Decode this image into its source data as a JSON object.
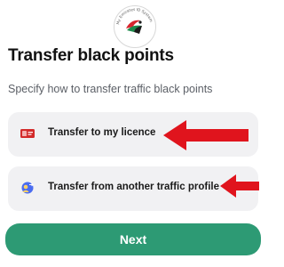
{
  "logo": {
    "arc_text": "My Emirates ID System",
    "icon": "falcon-emblem-icon",
    "colors": {
      "red": "#d7262e",
      "green": "#1f8a4c",
      "black": "#1b1b1b"
    }
  },
  "header": {
    "title": "Transfer black points",
    "subtitle": "Specify how to transfer traffic black points"
  },
  "options": [
    {
      "label": "Transfer to my licence",
      "icon": "licence-card-icon"
    },
    {
      "label": "Transfer from another traffic profile",
      "icon": "profile-swap-icon"
    }
  ],
  "annotations": {
    "arrow_color": "#e0141d"
  },
  "footer": {
    "next_label": "Next",
    "button_color": "#2d9a74"
  }
}
